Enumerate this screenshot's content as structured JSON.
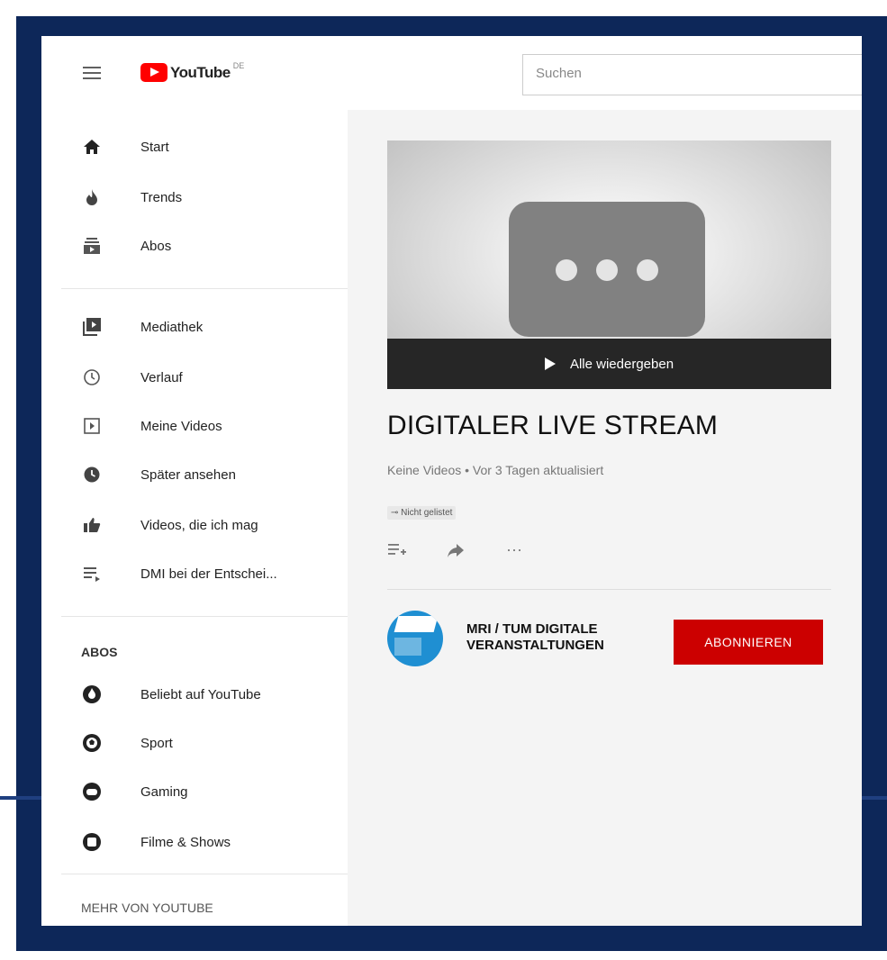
{
  "header": {
    "logo_text": "YouTube",
    "country_code": "DE",
    "search_placeholder": "Suchen"
  },
  "sidebar": {
    "main_items": [
      {
        "label": "Start",
        "icon": "home-icon"
      },
      {
        "label": "Trends",
        "icon": "flame-icon"
      },
      {
        "label": "Abos",
        "icon": "subscriptions-icon"
      }
    ],
    "library_items": [
      {
        "label": "Mediathek",
        "icon": "library-icon"
      },
      {
        "label": "Verlauf",
        "icon": "history-icon"
      },
      {
        "label": "Meine Videos",
        "icon": "my-videos-icon"
      },
      {
        "label": "Später ansehen",
        "icon": "watch-later-icon"
      },
      {
        "label": "Videos, die ich mag",
        "icon": "thumb-up-icon"
      },
      {
        "label": "DMI bei der Entschei...",
        "icon": "playlist-icon"
      }
    ],
    "abos_title": "ABOS",
    "abos_items": [
      {
        "label": "Beliebt auf YouTube",
        "icon": "popular-channel-icon"
      },
      {
        "label": "Sport",
        "icon": "sport-channel-icon"
      },
      {
        "label": "Gaming",
        "icon": "gaming-channel-icon"
      },
      {
        "label": "Filme & Shows",
        "icon": "movies-channel-icon"
      }
    ],
    "more_title": "MEHR VON YOUTUBE"
  },
  "playlist": {
    "play_all_label": "Alle wiedergeben",
    "title": "DIGITALER LIVE STREAM",
    "meta": "Keine Videos • Vor 3 Tagen aktualisiert",
    "visibility": "Nicht gelistet",
    "more_label": "···"
  },
  "channel": {
    "name": "MRI / TUM DIGITALE VERANSTALTUNGEN",
    "subscribe_label": "ABONNIEREN"
  },
  "colors": {
    "frame": "#0d2759",
    "brand_red": "#ff0000",
    "subscribe_red": "#cc0000"
  }
}
